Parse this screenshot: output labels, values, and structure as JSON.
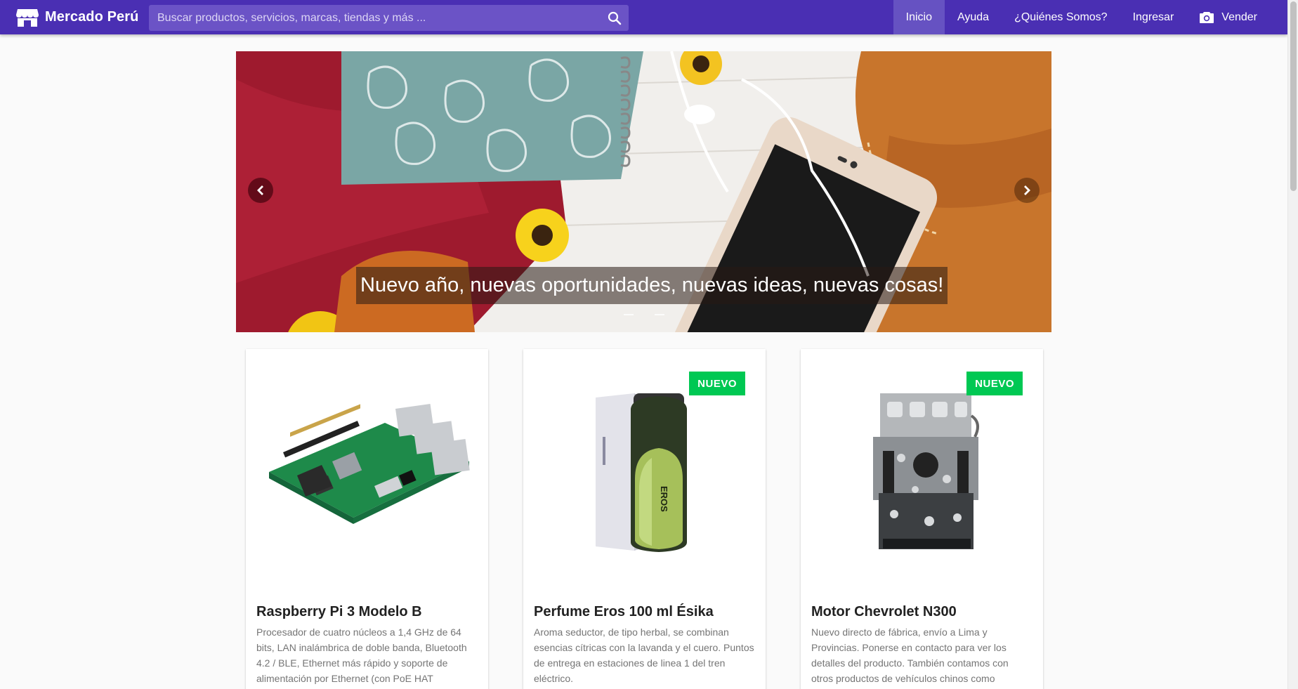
{
  "colors": {
    "appbar": "#4a2fb3",
    "appbar_active": "#6652c2",
    "search_bg": "#6b53c6",
    "badge": "#00c853"
  },
  "header": {
    "brand": "Mercado Perú",
    "brand_icon": "store-icon",
    "search": {
      "placeholder": "Buscar productos, servicios, marcas, tiendas y más ...",
      "value": "",
      "icon": "search-icon"
    },
    "nav": [
      {
        "label": "Inicio",
        "active": true
      },
      {
        "label": "Ayuda"
      },
      {
        "label": "¿Quiénes Somos?"
      },
      {
        "label": "Ingresar"
      },
      {
        "label": "Vender",
        "icon": "camera-icon"
      }
    ]
  },
  "carousel": {
    "caption": "Nuevo año, nuevas oportunidades, nuevas ideas, nuevas cosas!",
    "slide_count": 2,
    "prev_icon": "chevron-left-icon",
    "next_icon": "chevron-right-icon"
  },
  "products": [
    {
      "title": "Raspberry Pi 3 Modelo B",
      "description": "Procesador de cuatro núcleos a 1,4 GHz de 64 bits, LAN inalámbrica de doble banda, Bluetooth 4.2 / BLE, Ethernet más rápido y soporte de alimentación por Ethernet (con PoE HAT",
      "badge": ""
    },
    {
      "title": "Perfume Eros 100 ml Ésika",
      "description": "Aroma seductor, de tipo herbal, se combinan esencias cítricas con la lavanda y el cuero. Puntos de entrega en estaciones de linea 1 del tren eléctrico.",
      "badge": "NUEVO",
      "image_text": "EROS"
    },
    {
      "title": "Motor Chevrolet N300",
      "description": "Nuevo directo de fábrica, envío a Lima y Provincias. Ponerse en contacto para ver los detalles del producto. También contamos con otros productos de vehículos chinos como",
      "badge": "NUEVO"
    }
  ]
}
